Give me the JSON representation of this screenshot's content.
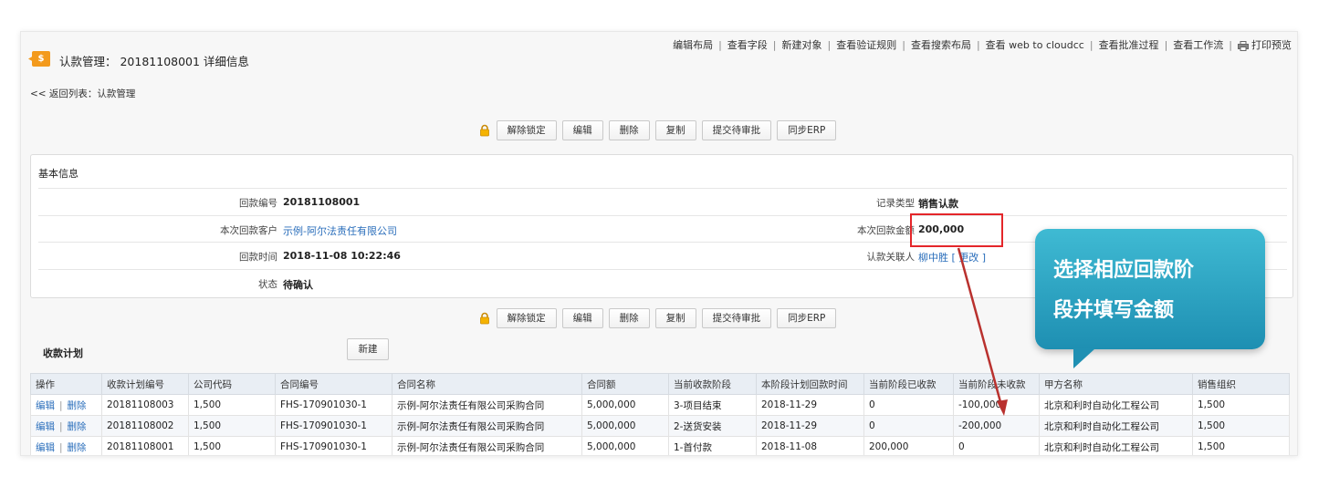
{
  "header": {
    "icon_symbol": "$",
    "icon_color": "#f39a1c",
    "title": "认款管理： 20181108001 详细信息",
    "links": [
      "编辑布局",
      "查看字段",
      "新建对象",
      "查看验证规则",
      "查看搜索布局",
      "查看 web to cloudcc",
      "查看批准过程",
      "查看工作流"
    ],
    "print_label": "打印预览",
    "back_link": "<< 返回列表：认款管理"
  },
  "buttons": [
    "解除锁定",
    "编辑",
    "删除",
    "复制",
    "提交待审批",
    "同步ERP"
  ],
  "basic_info": {
    "title": "基本信息",
    "fields": [
      {
        "label": "回款编号",
        "value": "20181108001"
      },
      {
        "label": "本次回款客户",
        "value": "示例-阿尔法责任有限公司"
      },
      {
        "label": "回款时间",
        "value": "2018-11-08 10:22:46"
      },
      {
        "label": "状态",
        "value": "待确认"
      },
      {
        "label": "记录类型",
        "value": "销售认款"
      },
      {
        "label": "本次回款金额",
        "value": "200,000"
      },
      {
        "label": "认款关联人",
        "value": "柳中胜",
        "action": "[ 更改 ]"
      }
    ]
  },
  "plan": {
    "title": "收款计划",
    "new_button": "新建",
    "columns": [
      "操作",
      "收款计划编号",
      "公司代码",
      "合同编号",
      "合同名称",
      "合同额",
      "当前收款阶段",
      "本阶段计划回款时间",
      "当前阶段已收款",
      "当前阶段未收款",
      "甲方名称",
      "销售组织"
    ],
    "edit_label": "编辑",
    "delete_label": "删除",
    "rows": [
      [
        "20181108003",
        "1,500",
        "FHS-170901030-1",
        "示例-阿尔法责任有限公司采购合同",
        "5,000,000",
        "3-项目结束",
        "2018-11-29",
        "0",
        "-100,000",
        "北京和利时自动化工程公司",
        "1,500"
      ],
      [
        "20181108002",
        "1,500",
        "FHS-170901030-1",
        "示例-阿尔法责任有限公司采购合同",
        "5,000,000",
        "2-送货安装",
        "2018-11-29",
        "0",
        "-200,000",
        "北京和利时自动化工程公司",
        "1,500"
      ],
      [
        "20181108001",
        "1,500",
        "FHS-170901030-1",
        "示例-阿尔法责任有限公司采购合同",
        "5,000,000",
        "1-首付款",
        "2018-11-08",
        "200,000",
        "0",
        "北京和利时自动化工程公司",
        "1,500"
      ]
    ]
  },
  "annotation": {
    "lines": [
      "选择相应回款阶",
      "段并填写金额"
    ],
    "box_color": "#e4262a",
    "callout_color": "#2aa6c6"
  }
}
